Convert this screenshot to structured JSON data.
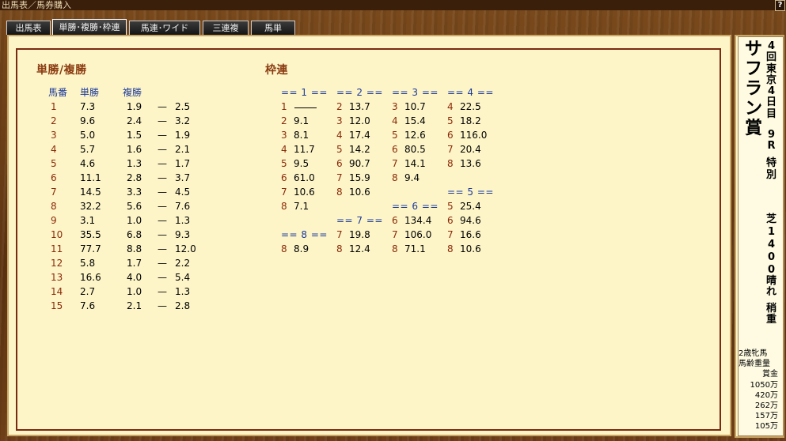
{
  "window": {
    "title": "出馬表／馬券購入",
    "help": "?"
  },
  "tabs": [
    {
      "label": "出馬表",
      "active": false
    },
    {
      "label": "単勝･複勝･枠連",
      "active": true
    },
    {
      "label": "馬連･ワイド",
      "active": false
    },
    {
      "label": "三連複",
      "active": false
    },
    {
      "label": "馬単",
      "active": false
    }
  ],
  "win_place": {
    "title": "単勝/複勝",
    "headers": {
      "horse": "馬番",
      "win": "単勝",
      "place": "複勝"
    },
    "rows": [
      {
        "no": "1",
        "win": "7.3",
        "pmin": "1.9",
        "sep": "—",
        "pmax": "2.5"
      },
      {
        "no": "2",
        "win": "9.6",
        "pmin": "2.4",
        "sep": "—",
        "pmax": "3.2"
      },
      {
        "no": "3",
        "win": "5.0",
        "pmin": "1.5",
        "sep": "—",
        "pmax": "1.9"
      },
      {
        "no": "4",
        "win": "5.7",
        "pmin": "1.6",
        "sep": "—",
        "pmax": "2.1"
      },
      {
        "no": "5",
        "win": "4.6",
        "pmin": "1.3",
        "sep": "—",
        "pmax": "1.7"
      },
      {
        "no": "6",
        "win": "11.1",
        "pmin": "2.8",
        "sep": "—",
        "pmax": "3.7"
      },
      {
        "no": "7",
        "win": "14.5",
        "pmin": "3.3",
        "sep": "—",
        "pmax": "4.5"
      },
      {
        "no": "8",
        "win": "32.2",
        "pmin": "5.6",
        "sep": "—",
        "pmax": "7.6"
      },
      {
        "no": "9",
        "win": "3.1",
        "pmin": "1.0",
        "sep": "—",
        "pmax": "1.3"
      },
      {
        "no": "10",
        "win": "35.5",
        "pmin": "6.8",
        "sep": "—",
        "pmax": "9.3"
      },
      {
        "no": "11",
        "win": "77.7",
        "pmin": "8.8",
        "sep": "—",
        "pmax": "12.0"
      },
      {
        "no": "12",
        "win": "5.8",
        "pmin": "1.7",
        "sep": "—",
        "pmax": "2.2"
      },
      {
        "no": "13",
        "win": "16.6",
        "pmin": "4.0",
        "sep": "—",
        "pmax": "5.4"
      },
      {
        "no": "14",
        "win": "2.7",
        "pmin": "1.0",
        "sep": "—",
        "pmax": "1.3"
      },
      {
        "no": "15",
        "win": "7.6",
        "pmin": "2.1",
        "sep": "—",
        "pmax": "2.8"
      }
    ]
  },
  "bracket": {
    "title": "枠連",
    "groups": [
      {
        "header": "== 1 ==",
        "entries": [
          {
            "n": "1",
            "odds": ""
          },
          {
            "n": "2",
            "odds": "9.1"
          },
          {
            "n": "3",
            "odds": "8.1"
          },
          {
            "n": "4",
            "odds": "11.7"
          },
          {
            "n": "5",
            "odds": "9.5"
          },
          {
            "n": "6",
            "odds": "61.0"
          },
          {
            "n": "7",
            "odds": "10.6"
          },
          {
            "n": "8",
            "odds": "7.1"
          }
        ]
      },
      {
        "header": "== 2 ==",
        "entries": [
          {
            "n": "2",
            "odds": "13.7"
          },
          {
            "n": "3",
            "odds": "12.0"
          },
          {
            "n": "4",
            "odds": "17.4"
          },
          {
            "n": "5",
            "odds": "14.2"
          },
          {
            "n": "6",
            "odds": "90.7"
          },
          {
            "n": "7",
            "odds": "15.9"
          },
          {
            "n": "8",
            "odds": "10.6"
          }
        ]
      },
      {
        "header": "== 3 ==",
        "entries": [
          {
            "n": "3",
            "odds": "10.7"
          },
          {
            "n": "4",
            "odds": "15.4"
          },
          {
            "n": "5",
            "odds": "12.6"
          },
          {
            "n": "6",
            "odds": "80.5"
          },
          {
            "n": "7",
            "odds": "14.1"
          },
          {
            "n": "8",
            "odds": "9.4"
          }
        ]
      },
      {
        "header": "== 4 ==",
        "entries": [
          {
            "n": "4",
            "odds": "22.5"
          },
          {
            "n": "5",
            "odds": "18.2"
          },
          {
            "n": "6",
            "odds": "116.0"
          },
          {
            "n": "7",
            "odds": "20.4"
          },
          {
            "n": "8",
            "odds": "13.6"
          }
        ]
      },
      {
        "header": "== 5 ==",
        "entries": [
          {
            "n": "5",
            "odds": "25.4"
          },
          {
            "n": "6",
            "odds": "94.6"
          },
          {
            "n": "7",
            "odds": "16.6"
          },
          {
            "n": "8",
            "odds": "10.6"
          }
        ]
      },
      {
        "header": "== 6 ==",
        "entries": [
          {
            "n": "6",
            "odds": "134.4"
          },
          {
            "n": "7",
            "odds": "106.0"
          },
          {
            "n": "8",
            "odds": "71.1"
          }
        ]
      },
      {
        "header": "== 7 ==",
        "entries": [
          {
            "n": "7",
            "odds": "19.8"
          },
          {
            "n": "8",
            "odds": "12.4"
          }
        ]
      },
      {
        "header": "== 8 ==",
        "entries": [
          {
            "n": "8",
            "odds": "8.9"
          }
        ]
      }
    ]
  },
  "race": {
    "name_chars": [
      "サ",
      "フ",
      "ラ",
      "ン",
      "賞"
    ],
    "meeting_chars": [
      "4",
      "回",
      "東",
      "京",
      "4",
      "日",
      "目"
    ],
    "race_no_chars": [
      "9",
      "R"
    ],
    "class_chars": [
      "特",
      "別"
    ],
    "course_chars": [
      "芝",
      "1",
      "4",
      "0",
      "0"
    ],
    "weather_chars": [
      "晴",
      "れ"
    ],
    "going_chars": [
      "稍",
      "重"
    ],
    "conditions": [
      "2歳牝馬",
      "馬齢重量"
    ],
    "prize_label": "賞金",
    "prizes": [
      "1050万",
      "420万",
      "262万",
      "157万",
      "105万"
    ]
  }
}
